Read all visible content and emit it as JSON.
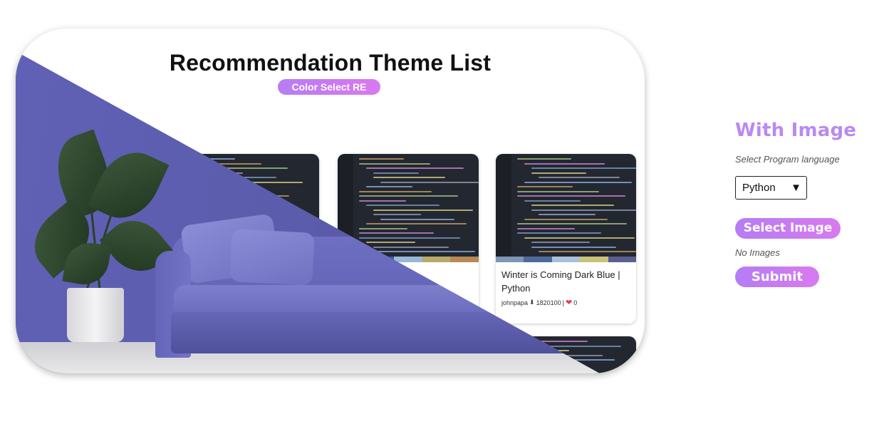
{
  "hero": {
    "title": "Recommendation Theme List",
    "badge": "Color Select RE",
    "featured_card": {
      "title": "Winter is Coming Dark Blue | Python",
      "author": "johnpapa",
      "downloads": "1820100",
      "likes": "0",
      "palette": [
        "#7f95b5",
        "#4e6a9a",
        "#a8c0d8",
        "#c8c27a",
        "#5a5e8e"
      ]
    },
    "icons": {
      "download": "download-icon",
      "like": "heart-icon"
    }
  },
  "form": {
    "heading": "With Image",
    "language_label": "Select Program language",
    "language_selected": "Python",
    "select_image_label": "Select Image",
    "status": "No Images",
    "submit_label": "Submit"
  },
  "colors": {
    "accent_start": "#b57df4",
    "accent_end": "#d97aef",
    "heading": "#b98af2"
  }
}
